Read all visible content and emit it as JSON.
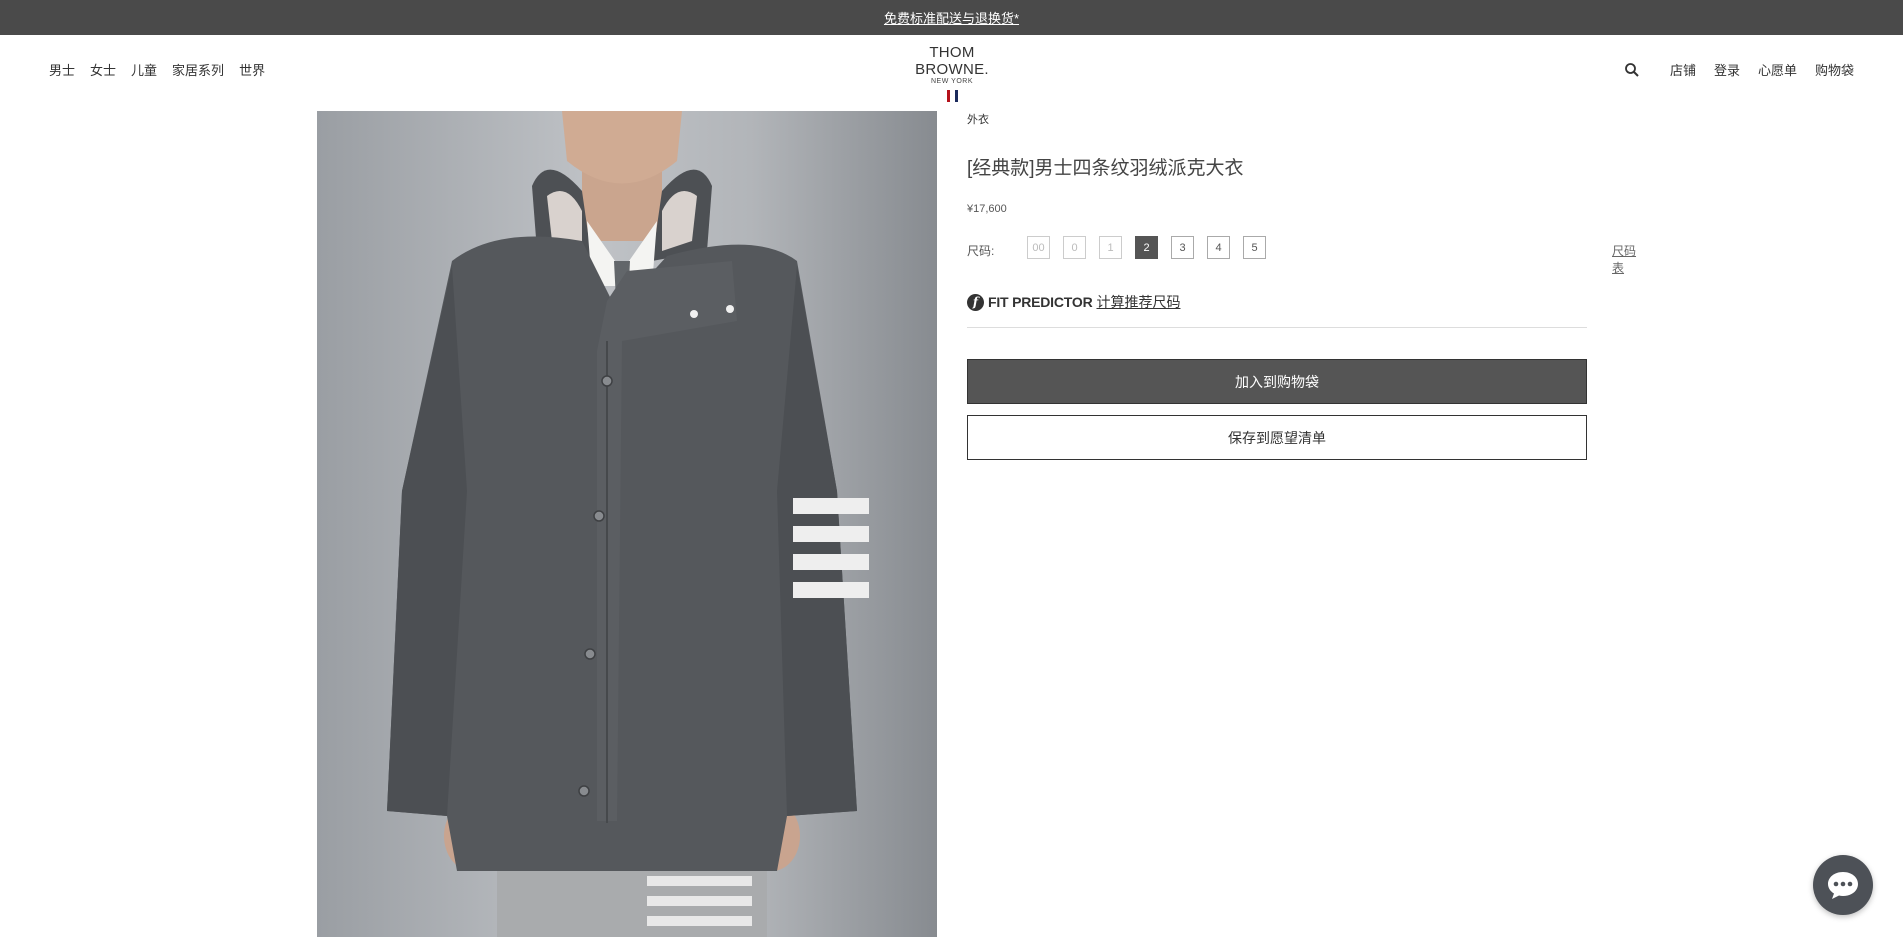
{
  "banner": {
    "text": "免费标准配送与退换货*"
  },
  "nav_left": [
    "男士",
    "女士",
    "儿童",
    "家居系列",
    "世界"
  ],
  "logo": {
    "brand": "THOM BROWNE.",
    "city": "NEW YORK"
  },
  "flag_colors": [
    "#b5121b",
    "#ffffff",
    "#1b2a5c"
  ],
  "nav_right": {
    "stores": "店铺",
    "login": "登录",
    "wishlist": "心愿单",
    "bag": "购物袋"
  },
  "product": {
    "category": "外衣",
    "title": "[经典款]男士四条纹羽绒派克大衣",
    "price": "¥17,600",
    "size_label": "尺码:",
    "sizes": [
      {
        "label": "00",
        "state": "disabled"
      },
      {
        "label": "0",
        "state": "disabled"
      },
      {
        "label": "1",
        "state": "disabled"
      },
      {
        "label": "2",
        "state": "selected"
      },
      {
        "label": "3",
        "state": "available"
      },
      {
        "label": "4",
        "state": "available"
      },
      {
        "label": "5",
        "state": "available"
      }
    ],
    "size_chart": "尺码表",
    "fit_predictor": {
      "icon": "f",
      "brand": "FIT PREDICTOR",
      "link": "计算推荐尺码"
    },
    "add_to_bag": "加入到购物袋",
    "save_wishlist": "保存到愿望清单"
  },
  "colors": {
    "banner_bg": "#4a4a4a",
    "button_bg": "#555555",
    "jacket": "#55585c"
  },
  "icons": {
    "search": "search-icon",
    "chat": "chat-icon"
  }
}
